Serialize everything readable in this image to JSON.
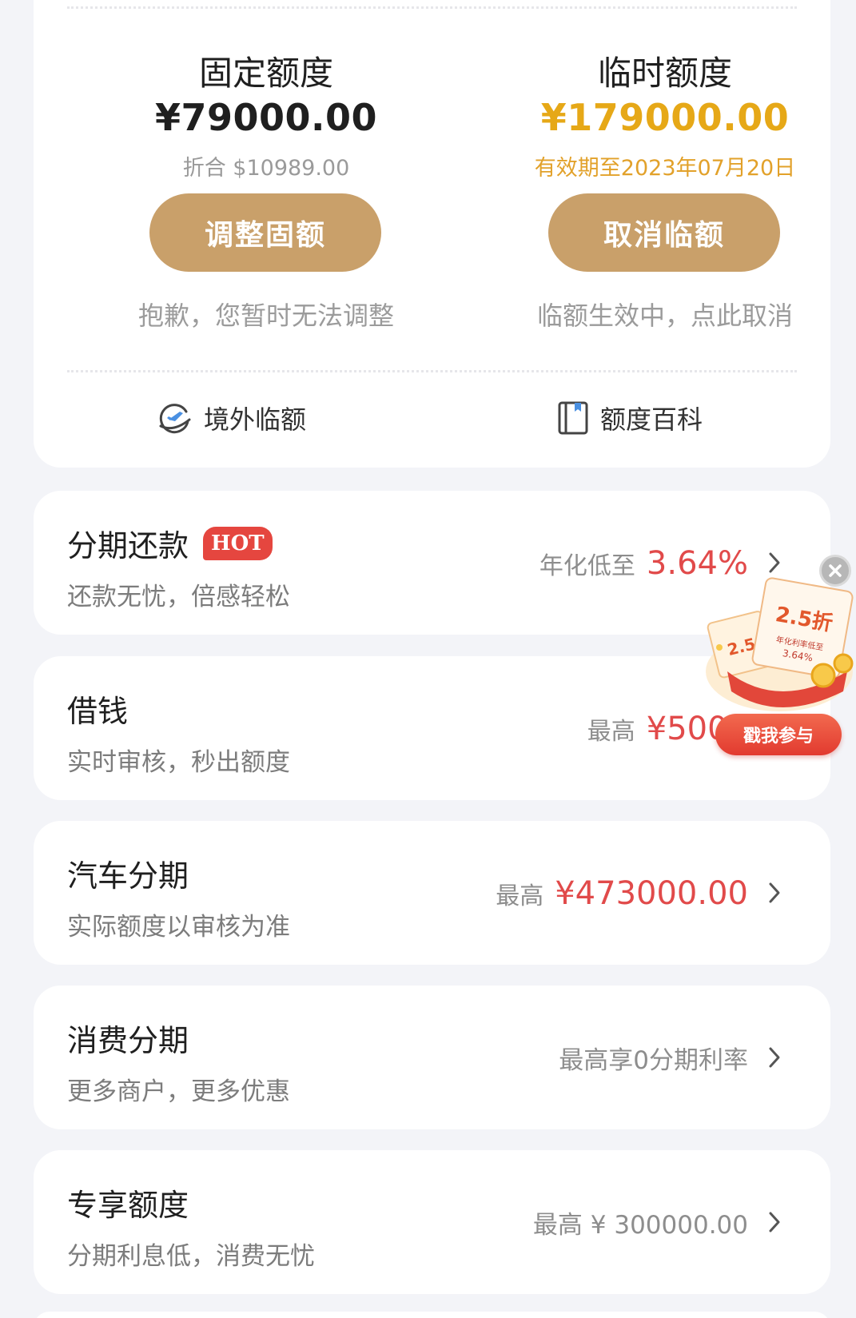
{
  "limits": {
    "fixed": {
      "title": "固定额度",
      "amount": "¥79000.00",
      "converted": "折合 $10989.00",
      "button": "调整固额",
      "note": "抱歉，您暂时无法调整"
    },
    "temporary": {
      "title": "临时额度",
      "amount": "¥179000.00",
      "validity": "有效期至2023年07月20日",
      "button": "取消临额",
      "note": "临额生效中，点此取消"
    },
    "links": {
      "overseas": "境外临额",
      "encyclopedia": "额度百科"
    }
  },
  "items": [
    {
      "title": "分期还款",
      "badge": "HOT",
      "subtitle": "还款无忧，倍感轻松",
      "label": "年化低至",
      "value": "3.64%"
    },
    {
      "title": "借钱",
      "subtitle": "实时审核，秒出额度",
      "label": "最高",
      "value": "¥5000"
    },
    {
      "title": "汽车分期",
      "subtitle": "实际额度以审核为准",
      "label": "最高",
      "value": "¥473000.00"
    },
    {
      "title": "消费分期",
      "subtitle": "更多商户，更多优惠",
      "value": "最高享0分期利率"
    },
    {
      "title": "专享额度",
      "subtitle": "分期利息低，消费无忧",
      "value": "最高 ¥ 300000.00"
    }
  ],
  "promo": {
    "discount": "2.5折",
    "discount_small": "2.5",
    "rate_label": "年化利率低至",
    "rate": "3.64%",
    "button": "戳我参与"
  },
  "colors": {
    "gold_button": "#c9a06a",
    "gold_text": "#e6a817",
    "red_value": "#e14a4a",
    "hot_badge": "#e5463f"
  }
}
